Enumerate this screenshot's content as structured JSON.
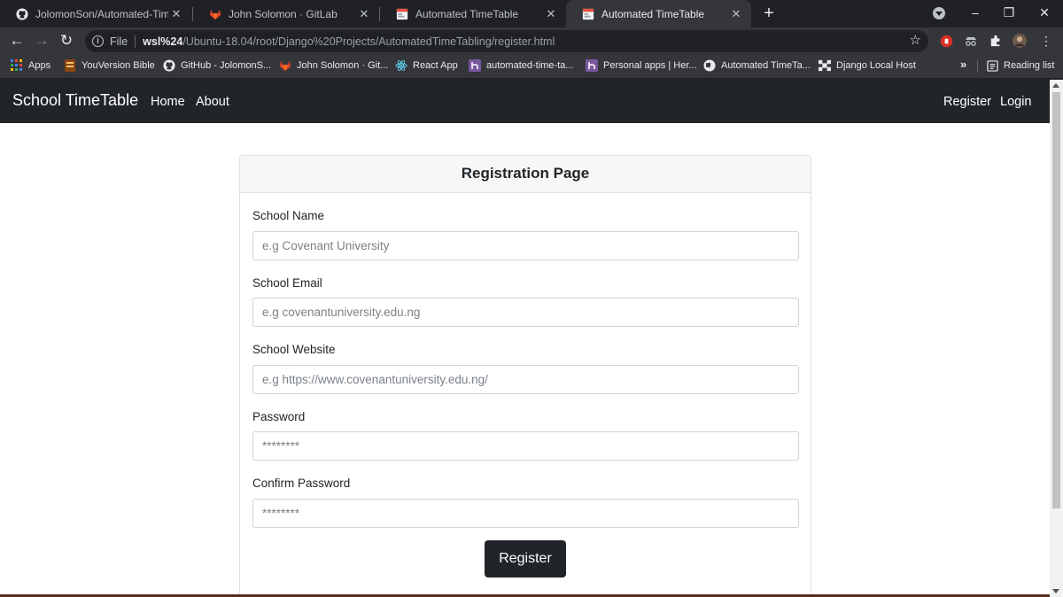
{
  "browser": {
    "tabs": [
      {
        "title": "JolomonSon/Automated-Time-Ta",
        "icon": "github-icon",
        "active": false
      },
      {
        "title": "John Solomon · GitLab",
        "icon": "gitlab-icon",
        "active": false
      },
      {
        "title": "Automated TimeTable",
        "icon": "page-icon",
        "active": false
      },
      {
        "title": "Automated TimeTable",
        "icon": "page-icon",
        "active": true
      }
    ],
    "new_tab": "+",
    "window_controls": {
      "minimize": "–",
      "restore": "❐",
      "close": "✕"
    },
    "url_scheme_label": "File",
    "url_host": "wsl%24",
    "url_path": "/Ubuntu-18.04/root/Django%20Projects/AutomatedTimeTabling/register.html",
    "bookmarks": [
      {
        "label": "Apps",
        "icon": "apps-grid-icon"
      },
      {
        "label": "YouVersion Bible",
        "icon": "bible-icon"
      },
      {
        "label": "GitHub - JolomonS...",
        "icon": "github-icon"
      },
      {
        "label": "John Solomon · Git...",
        "icon": "gitlab-icon"
      },
      {
        "label": "React App",
        "icon": "react-icon"
      },
      {
        "label": "automated-time-ta...",
        "icon": "heroku-icon"
      },
      {
        "label": "Personal apps | Her...",
        "icon": "heroku-icon"
      },
      {
        "label": "Automated TimeTa...",
        "icon": "globe-icon"
      },
      {
        "label": "Django Local Host",
        "icon": "django-icon"
      }
    ],
    "bookmarks_overflow": "»",
    "reading_list": "Reading list"
  },
  "site": {
    "brand": "School TimeTable",
    "nav_left": [
      "Home",
      "About"
    ],
    "nav_right": [
      "Register",
      "Login"
    ]
  },
  "form": {
    "title": "Registration Page",
    "fields": [
      {
        "label": "School Name",
        "placeholder": "e.g Covenant University"
      },
      {
        "label": "School Email",
        "placeholder": "e.g covenantuniversity.edu.ng"
      },
      {
        "label": "School Website",
        "placeholder": "e.g https://www.covenantuniversity.edu.ng/"
      },
      {
        "label": "Password",
        "placeholder": "********"
      },
      {
        "label": "Confirm Password",
        "placeholder": "********"
      }
    ],
    "submit_label": "Register"
  },
  "colors": {
    "navbar_bg": "#212529",
    "button_bg": "#212529",
    "card_header_bg": "#f7f7f7"
  }
}
